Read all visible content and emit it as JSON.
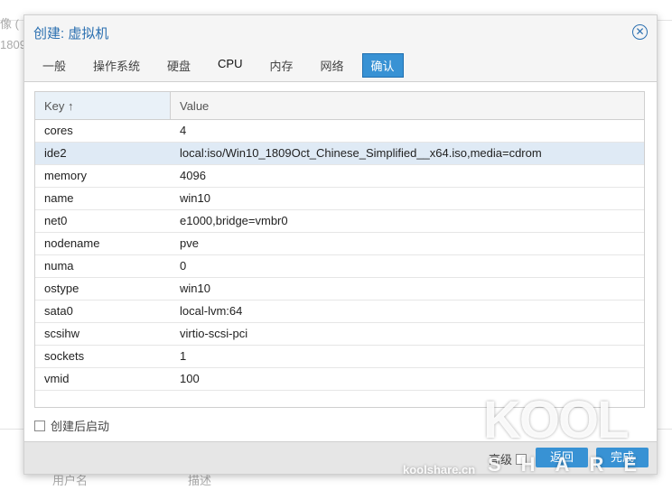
{
  "background": {
    "col1_header": "像 (",
    "col1_value": "1809",
    "col2_header": "用户名",
    "col3_header": "描述"
  },
  "dialog": {
    "title": "创建: 虚拟机",
    "tabs": [
      "一般",
      "操作系统",
      "硬盘",
      "CPU",
      "内存",
      "网络",
      "确认"
    ],
    "active_tab": "确认",
    "grid": {
      "columns": [
        "Key ↑",
        "Value"
      ],
      "rows": [
        {
          "key": "cores",
          "value": "4"
        },
        {
          "key": "ide2",
          "value": "local:iso/Win10_1809Oct_Chinese_Simplified__x64.iso,media=cdrom"
        },
        {
          "key": "memory",
          "value": "4096"
        },
        {
          "key": "name",
          "value": "win10"
        },
        {
          "key": "net0",
          "value": "e1000,bridge=vmbr0"
        },
        {
          "key": "nodename",
          "value": "pve"
        },
        {
          "key": "numa",
          "value": "0"
        },
        {
          "key": "ostype",
          "value": "win10"
        },
        {
          "key": "sata0",
          "value": "local-lvm:64"
        },
        {
          "key": "scsihw",
          "value": "virtio-scsi-pci"
        },
        {
          "key": "sockets",
          "value": "1"
        },
        {
          "key": "vmid",
          "value": "100"
        }
      ]
    },
    "start_after_create": "创建后启动",
    "advanced": "高级",
    "back": "返回",
    "finish": "完成"
  },
  "watermark": {
    "logo": "KOOL",
    "sub": "SHARE",
    "site": "koolshare.cn"
  }
}
